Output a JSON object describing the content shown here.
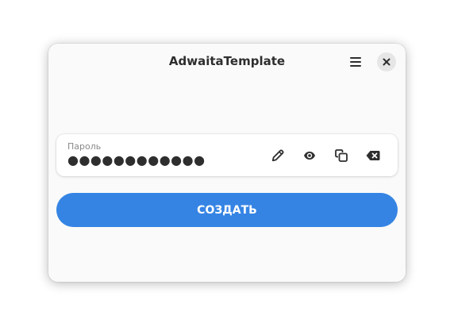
{
  "window": {
    "title": "AdwaitaTemplate"
  },
  "headerbar": {
    "menu_icon": "open-menu-icon",
    "close_icon": "close-icon"
  },
  "password_row": {
    "label": "Пароль",
    "value": "●●●●●●●●●●●●",
    "buttons": [
      {
        "name": "edit",
        "icon": "pencil-icon"
      },
      {
        "name": "show",
        "icon": "eye-icon"
      },
      {
        "name": "copy",
        "icon": "copy-icon"
      },
      {
        "name": "clear",
        "icon": "backspace-icon"
      }
    ]
  },
  "create_button": {
    "label": "СОЗДАТЬ"
  },
  "colors": {
    "accent": "#3584e4",
    "window_bg": "#fafafa",
    "text": "#2e2e2e"
  }
}
